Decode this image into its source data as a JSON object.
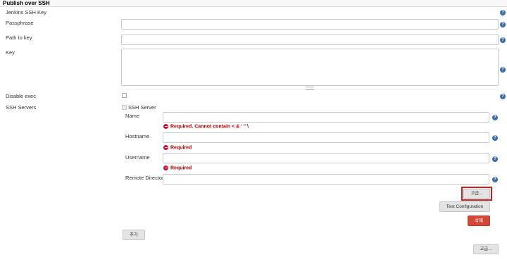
{
  "section": {
    "title": "Publish over SSH"
  },
  "jenkins_ssh_key": {
    "label": "Jenkins SSH Key"
  },
  "fields": {
    "passphrase": {
      "label": "Passphrase",
      "value": ""
    },
    "path_to_key": {
      "label": "Path to key",
      "value": ""
    },
    "key": {
      "label": "Key",
      "value": ""
    },
    "disable_exec": {
      "label": "Disable exec",
      "checked": false
    }
  },
  "ssh_servers": {
    "label": "SSH Servers",
    "server": {
      "header": "SSH Server",
      "name": {
        "label": "Name",
        "value": "",
        "error": "Required. Cannot contain < & ' \" \\"
      },
      "hostname": {
        "label": "Hostname",
        "value": "",
        "error": "Required"
      },
      "username": {
        "label": "Username",
        "value": "",
        "error": "Required"
      },
      "remote_directory": {
        "label": "Remote Directory",
        "value": ""
      },
      "advanced_button": "고급...",
      "test_button": "Test Configuration",
      "delete_button": "삭제"
    },
    "add_button": "추가"
  },
  "bottom_advanced_button": "고급...",
  "help_glyph": "?",
  "colors": {
    "error": "#b20000",
    "delete": "#d24939",
    "help": "#3b6ea5",
    "highlight": "#d51a1a"
  }
}
